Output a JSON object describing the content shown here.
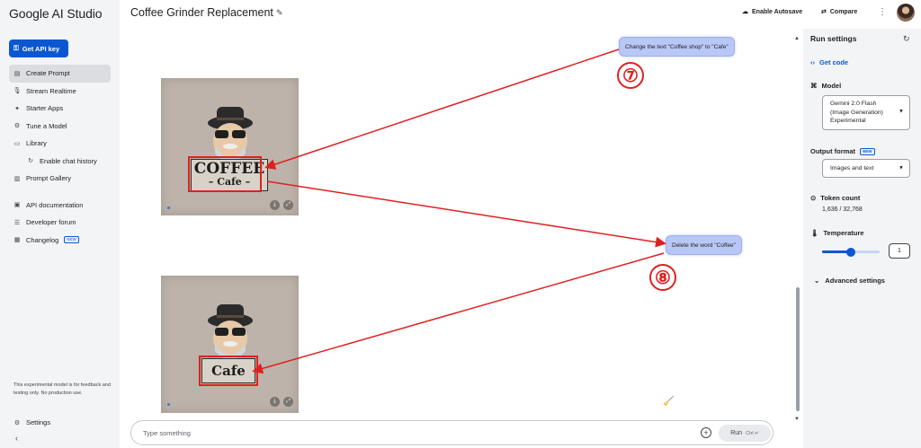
{
  "app": {
    "brand": "Google AI Studio"
  },
  "sidebar": {
    "api_key_label": "Get API key",
    "items": [
      {
        "label": "Create Prompt",
        "icon": "create-prompt-icon",
        "active": true
      },
      {
        "label": "Stream Realtime",
        "icon": "mic-icon"
      },
      {
        "label": "Starter Apps",
        "icon": "starter-apps-icon"
      },
      {
        "label": "Tune a Model",
        "icon": "tune-icon"
      },
      {
        "label": "Library",
        "icon": "library-icon"
      },
      {
        "label": "Enable chat history",
        "icon": "history-icon",
        "sub": true
      },
      {
        "label": "Prompt Gallery",
        "icon": "gallery-icon"
      },
      {
        "label": "API documentation",
        "icon": "docs-icon"
      },
      {
        "label": "Developer forum",
        "icon": "forum-icon"
      },
      {
        "label": "Changelog",
        "icon": "changelog-icon",
        "badge": "NEW"
      }
    ],
    "disclaimer": "This experimental model is for feedback and testing only. No production use.",
    "settings_label": "Settings"
  },
  "header": {
    "title": "Coffee Grinder Replacement",
    "autosave_label": "Enable Autosave",
    "compare_label": "Compare"
  },
  "chat": {
    "image1": {
      "sign_line1": "COFFEE",
      "sign_line2": "– Cafe –"
    },
    "image2": {
      "sign_line1": "Cafe"
    },
    "bubble1": "Change the text \"Coffee shop\" to \"Cafe\"",
    "bubble2": "Delete the word \"Coffee\"",
    "step1": "⑦",
    "step2": "⑧",
    "input_placeholder": "Type something",
    "run_label": "Run",
    "run_shortcut": "Ctrl ↵"
  },
  "run_settings": {
    "title": "Run settings",
    "get_code": "Get code",
    "model_label": "Model",
    "model_value": "Gemini 2.0 Flash (Image Generation) Experimental",
    "output_label": "Output format",
    "output_badge": "NEW",
    "output_value": "Images and text",
    "token_label": "Token count",
    "token_value": "1,636 / 32,768",
    "temp_label": "Temperature",
    "temp_value": "1",
    "temp_fraction": 0.5,
    "advanced_label": "Advanced settings"
  },
  "colors": {
    "accent": "#0b57d0",
    "annotation": "#e02020",
    "bubble": "#b8c7f5"
  }
}
